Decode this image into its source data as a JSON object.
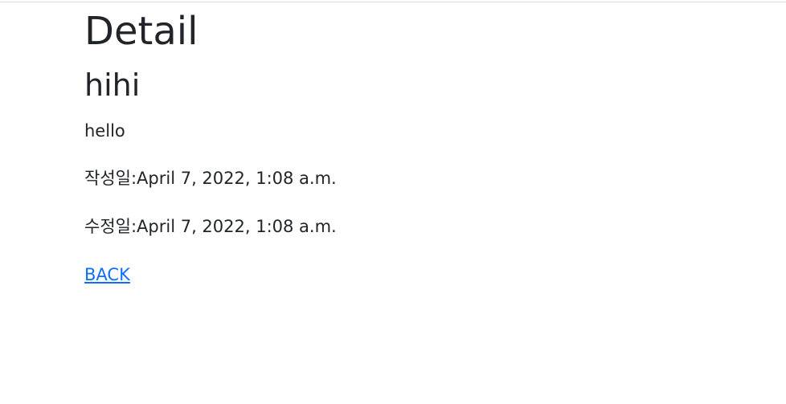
{
  "page": {
    "heading": "Detail"
  },
  "post": {
    "title": "hihi",
    "content": "hello",
    "created_label": "작성일:",
    "created_value": "April 7, 2022, 1:08 a.m.",
    "updated_label": "수정일:",
    "updated_value": "April 7, 2022, 1:08 a.m."
  },
  "actions": {
    "back_label": "BACK"
  },
  "colors": {
    "text": "#212529",
    "link": "#0d6efd",
    "divider": "#dcdcdc"
  }
}
